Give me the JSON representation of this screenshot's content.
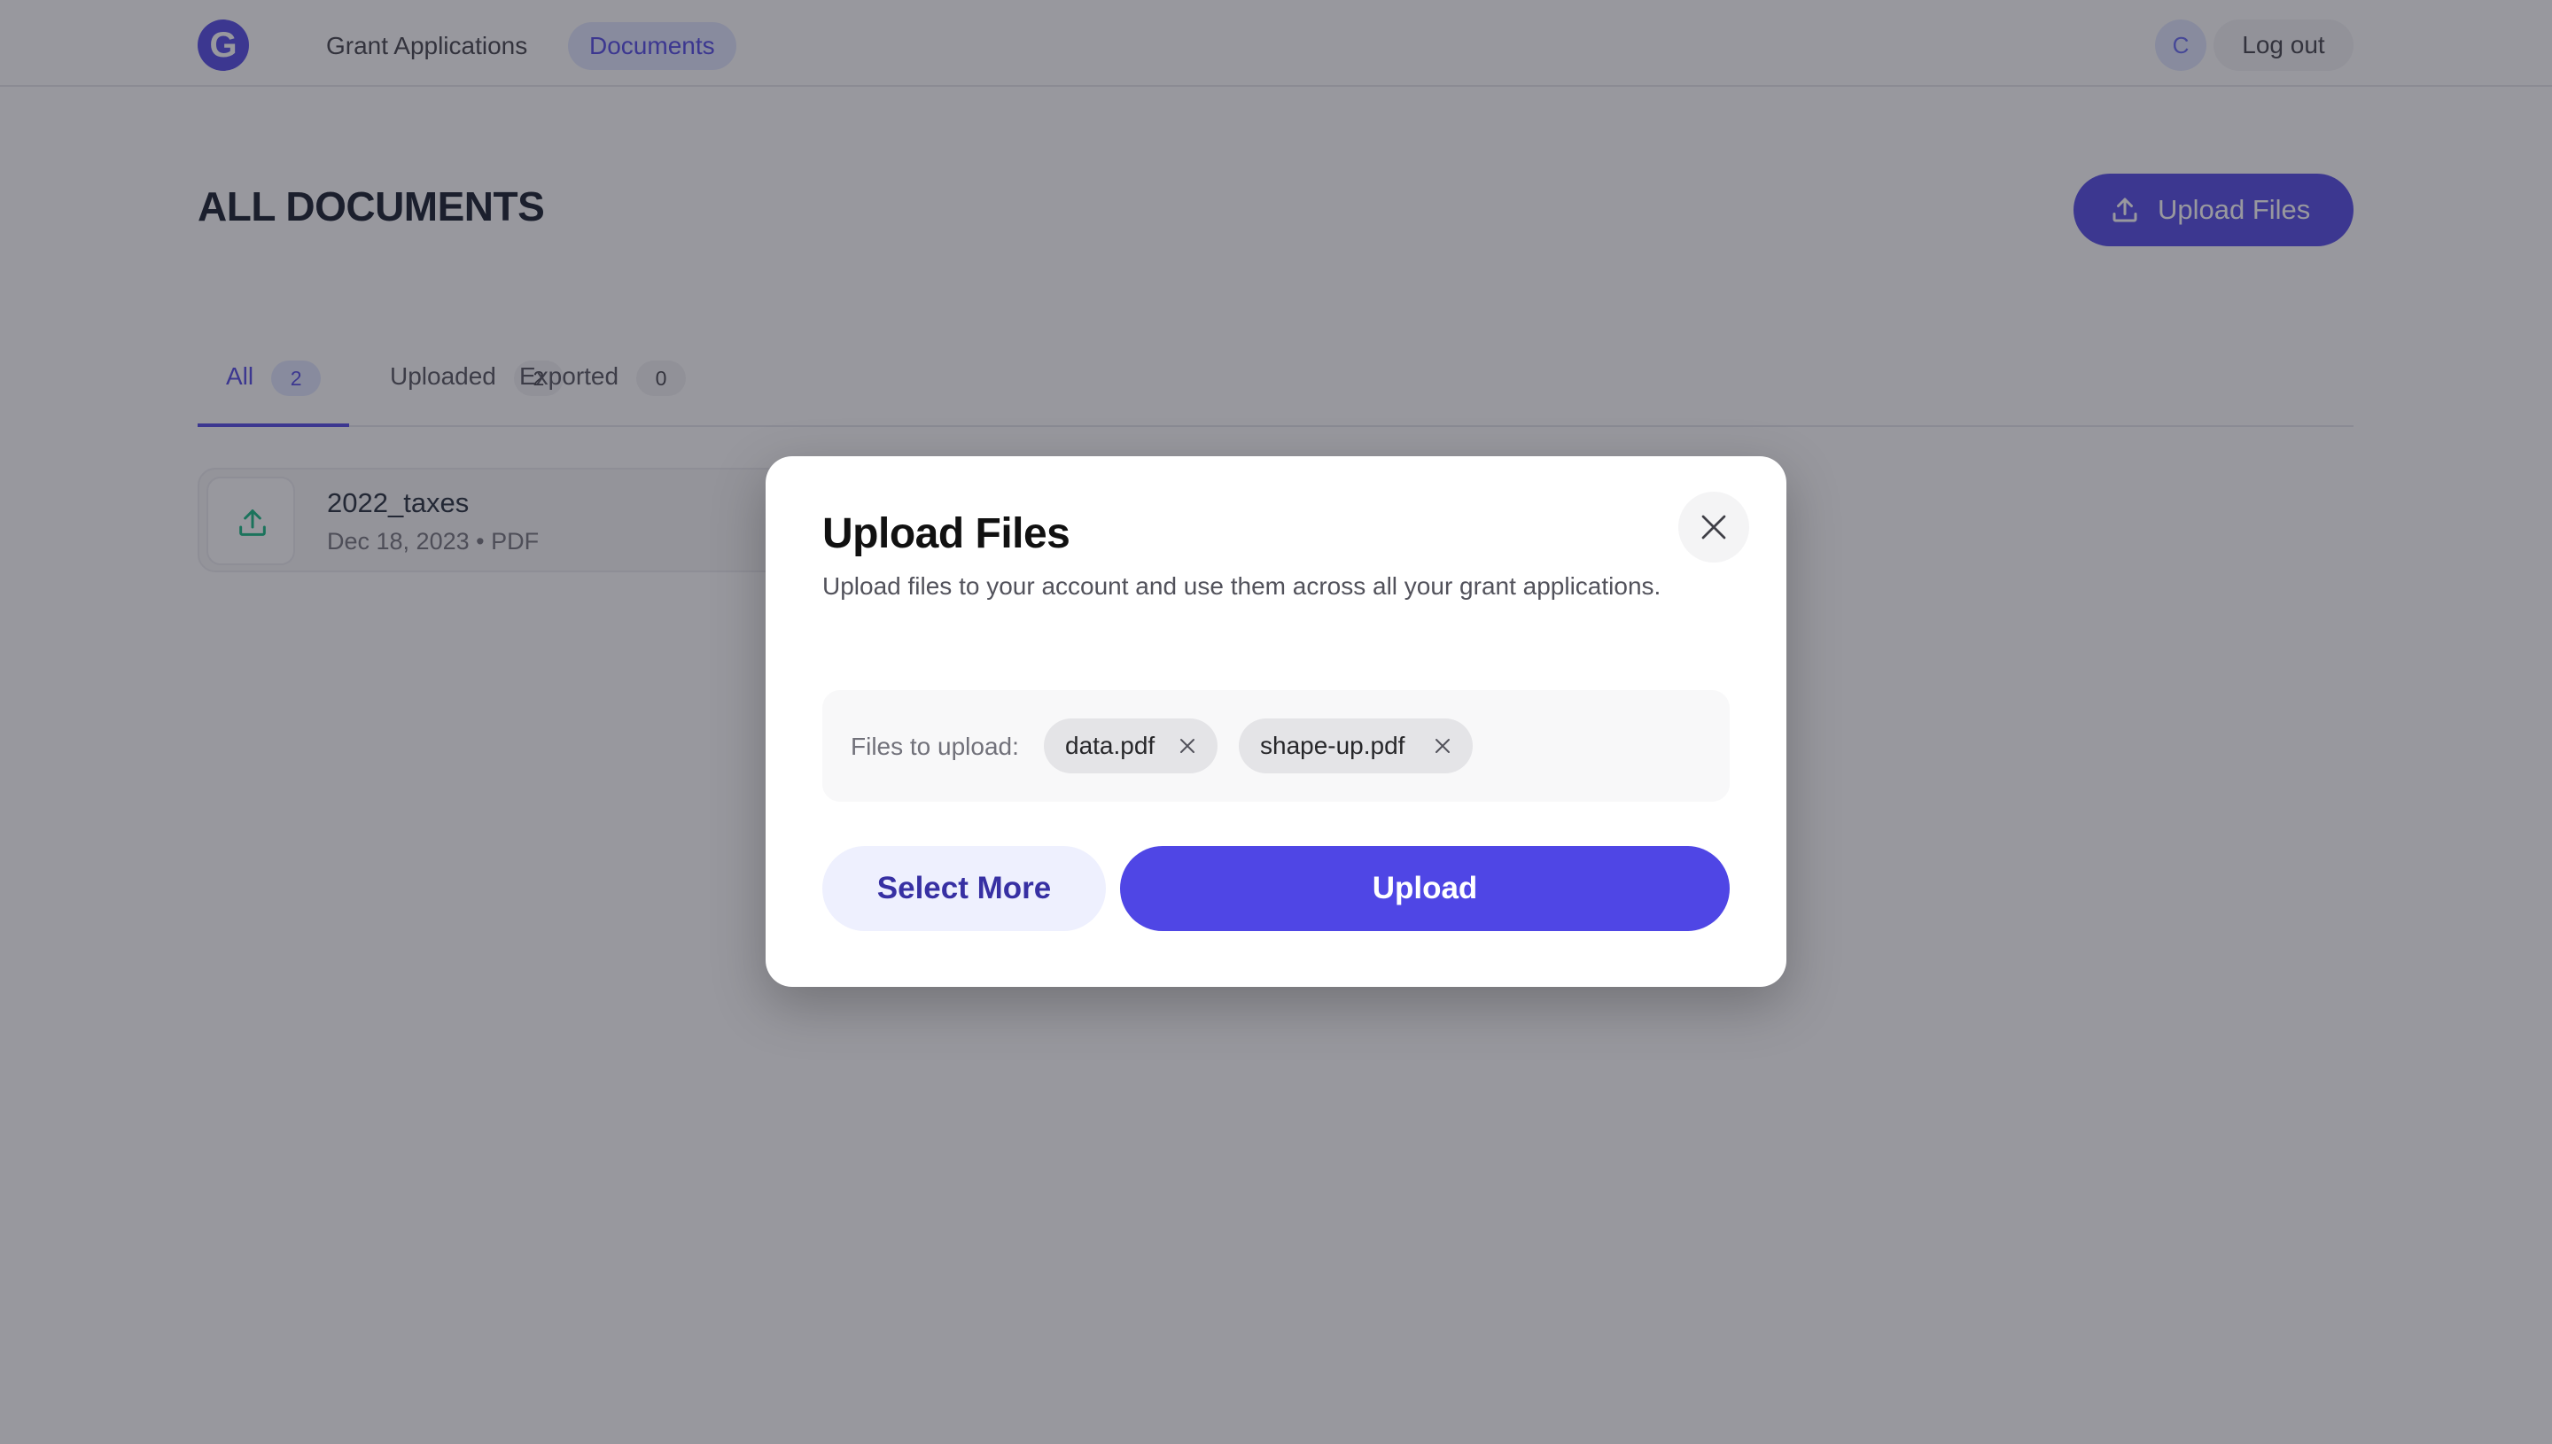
{
  "nav": {
    "logo_letter": "G",
    "links": [
      {
        "label": "Grant Applications"
      },
      {
        "label": "Documents"
      }
    ],
    "avatar_initial": "C",
    "logout_label": "Log out"
  },
  "header": {
    "title": "ALL DOCUMENTS",
    "upload_label": "Upload Files"
  },
  "tabs": [
    {
      "label": "All",
      "count": "2"
    },
    {
      "label": "Uploaded",
      "count": "2"
    },
    {
      "label": "Exported",
      "count": "0"
    }
  ],
  "documents": [
    {
      "name": "2022_taxes",
      "meta": "Dec 18, 2023 • PDF"
    }
  ],
  "modal": {
    "title": "Upload Files",
    "description": "Upload files to your account and use them across all your grant applications.",
    "files_label": "Files to upload:",
    "files": [
      {
        "name": "data.pdf"
      },
      {
        "name": "shape-up.pdf"
      }
    ],
    "select_more_label": "Select More",
    "upload_label": "Upload"
  },
  "colors": {
    "accent": "#4f46e5",
    "accent_light": "#e0e7ff",
    "overlay": "#28283480"
  }
}
